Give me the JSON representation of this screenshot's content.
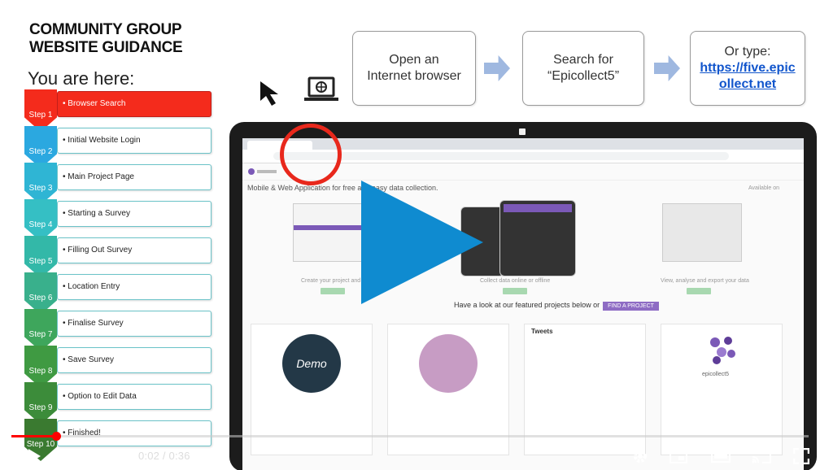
{
  "guide": {
    "title_line1": "COMMUNITY GROUP",
    "title_line2": "WEBSITE GUIDANCE",
    "you_are_here": "You are here:"
  },
  "steps": [
    {
      "label": "Step 1",
      "text": "• Browser Search",
      "color": "#f42b1c",
      "active": true
    },
    {
      "label": "Step 2",
      "text": "• Initial Website Login",
      "color": "#2ba8e0"
    },
    {
      "label": "Step 3",
      "text": "• Main Project Page",
      "color": "#2fb5d4"
    },
    {
      "label": "Step 4",
      "text": "• Starting a Survey",
      "color": "#35bfc4"
    },
    {
      "label": "Step 5",
      "text": "• Filling Out Survey",
      "color": "#33b8a8"
    },
    {
      "label": "Step 6",
      "text": "• Location Entry",
      "color": "#39b08c"
    },
    {
      "label": "Step 7",
      "text": "• Finalise Survey",
      "color": "#3ea65c"
    },
    {
      "label": "Step 8",
      "text": "• Save Survey",
      "color": "#3f9a42"
    },
    {
      "label": "Step 9",
      "text": "• Option to Edit Data",
      "color": "#3c8c3a"
    },
    {
      "label": "Step 10",
      "text": "• Finished!",
      "color": "#3a7a30"
    }
  ],
  "flow": {
    "box1": {
      "line1": "Open an",
      "line2": "Internet browser"
    },
    "box2": {
      "line1": "Search for",
      "line2": "“Epicollect5”"
    },
    "box3": {
      "line1": "Or type:",
      "link1": "https://five.epic",
      "link2": "ollect.net"
    }
  },
  "site": {
    "tagline": "Mobile & Web Application for free and easy data collection.",
    "available_on": "Available on",
    "col1": "Create your project and form",
    "col2": "Collect data online or offline",
    "col3": "View, analyse and export your data",
    "featured": "Have a look at our featured projects below or",
    "find_project": "FIND A PROJECT",
    "tweets": "Tweets",
    "demo": "Demo",
    "brand": "epicollect5"
  },
  "player": {
    "time": "0:02 / 0:36",
    "progress_fraction": 0.056
  }
}
